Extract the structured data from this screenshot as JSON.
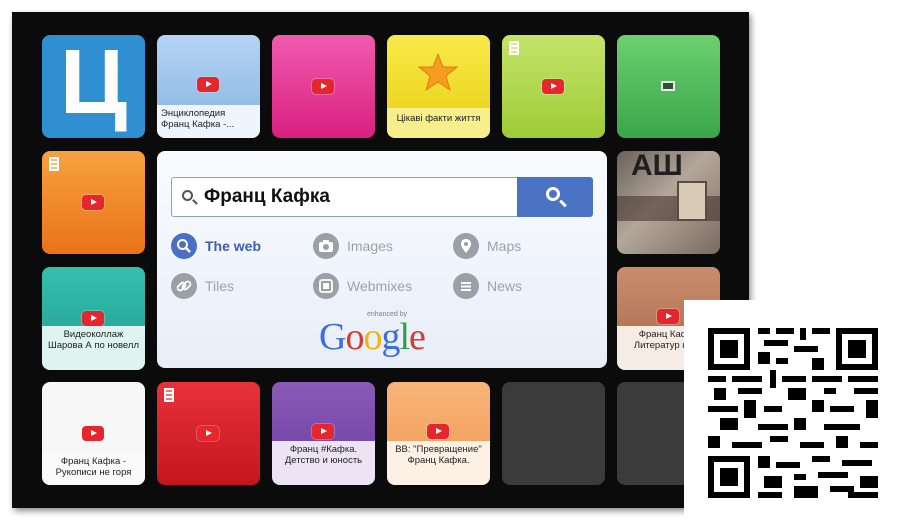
{
  "tiles": {
    "t1": {
      "letter": "Ц",
      "color": "#2f8fd0"
    },
    "t2": {
      "caption": "Энциклопедия Франц Кафка -...",
      "color": "#9fc4ec"
    },
    "t3": {
      "caption": "",
      "color": "#e63a98"
    },
    "t4": {
      "caption": "Цікаві факти життя",
      "color": "#f1df2b"
    },
    "t5": {
      "caption": "",
      "color": "#b5d84c"
    },
    "t6": {
      "caption": "",
      "color": "#4dbf53"
    },
    "t7": {
      "caption": "",
      "color": "#f08a26"
    },
    "t8": {
      "caption": "АШ",
      "color": "#8a7a6c"
    },
    "t9": {
      "caption": "Видеоколлаж Шарова А по новелл",
      "color": "#2fb2a5"
    },
    "t10": {
      "caption": "Франц Кафка Литератур насл",
      "color": "#c0795a"
    },
    "t11": {
      "caption": "Франц Кафка - Рукописи не горя",
      "color": "#f5f5f5"
    },
    "t12": {
      "caption": "",
      "color": "#d82027"
    },
    "t13": {
      "caption": "Франц #Кафка. Детство и юность",
      "color": "#7f4fb0"
    },
    "t14": {
      "caption": "BB: \"Превращение\" Франц Кафка.",
      "color": "#f6a967"
    },
    "t15": {
      "caption": "",
      "color": "#3a3a3a"
    },
    "t16": {
      "caption": "",
      "color": "#3a3a3a"
    }
  },
  "search": {
    "query": "Франц Кафка",
    "options": [
      {
        "label": "The web",
        "icon": "search-icon",
        "active": true
      },
      {
        "label": "Images",
        "icon": "camera-icon",
        "active": false
      },
      {
        "label": "Maps",
        "icon": "map-pin-icon",
        "active": false
      },
      {
        "label": "Tiles",
        "icon": "link-icon",
        "active": false
      },
      {
        "label": "Webmixes",
        "icon": "webmix-icon",
        "active": false
      },
      {
        "label": "News",
        "icon": "news-icon",
        "active": false
      }
    ],
    "enhanced_by": "enhanced by",
    "logo_text": "Google"
  }
}
